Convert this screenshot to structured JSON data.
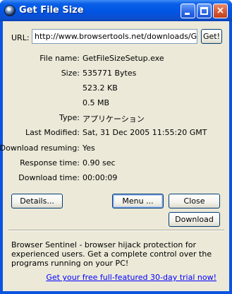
{
  "window": {
    "title": "Get File Size",
    "buttons": {
      "minimize": "minimize",
      "maximize": "maximize",
      "close": "×"
    }
  },
  "url": {
    "label": "URL:",
    "value": "http://www.browsertools.net/downloads/GetFileSizeSetup.exe",
    "get_button": "Get!"
  },
  "info": {
    "file_name": {
      "label": "File name:",
      "value": "GetFileSizeSetup.exe"
    },
    "size": {
      "label": "Size:",
      "value": "535771 Bytes"
    },
    "size_kb": "523.2 KB",
    "size_mb": "0.5 MB",
    "type": {
      "label": "Type:",
      "value": "アプリケーション"
    },
    "last_modified": {
      "label": "Last Modified:",
      "value": "Sat, 31 Dec 2005 11:55:20 GMT"
    },
    "download_resuming": {
      "label": "Download resuming:",
      "value": "Yes"
    },
    "response_time": {
      "label": "Response time:",
      "value": "0.90 sec"
    },
    "download_time": {
      "label": "Download time:",
      "value": "00:00:09"
    }
  },
  "buttons": {
    "details": "Details...",
    "menu": "Menu ...",
    "close": "Close",
    "download": "Download"
  },
  "ad": {
    "text": "Browser Sentinel - browser hijack protection for experienced users. Get a complete control over the programs running on your PC!",
    "link": "Get your free full-featured 30-day trial now!"
  },
  "colors": {
    "titlebar": "#0054e3",
    "dialog_background": "#ece9d8",
    "link": "#0000ff",
    "button_border": "#003c74"
  }
}
